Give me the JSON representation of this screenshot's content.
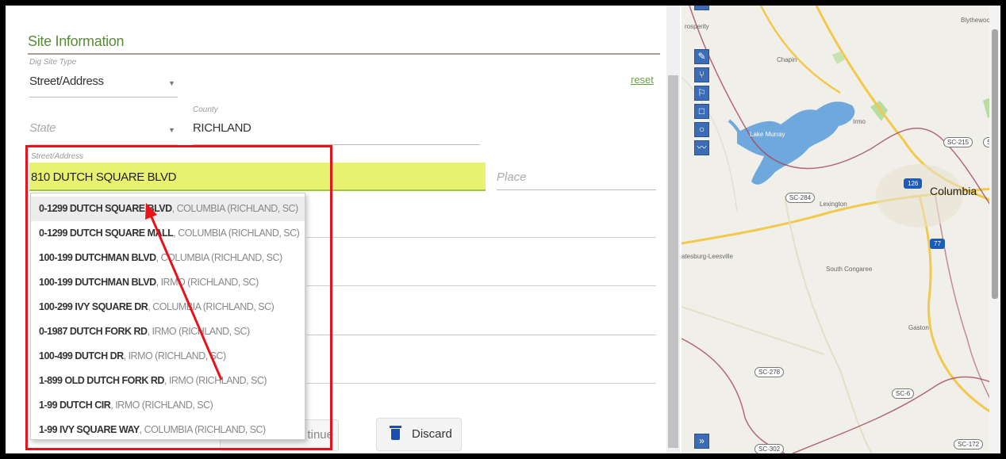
{
  "section": {
    "title": "Site Information"
  },
  "dig_site_type": {
    "label": "Dig Site Type",
    "value": "Street/Address"
  },
  "reset_label": "reset",
  "state": {
    "placeholder": "State"
  },
  "county": {
    "label": "County",
    "value": "RICHLAND"
  },
  "street": {
    "label": "Street/Address",
    "value": "810 DUTCH SQUARE BLVD"
  },
  "place": {
    "placeholder": "Place"
  },
  "suggestions": [
    {
      "main": "0-1299 DUTCH SQUARE BLVD",
      "detail": ", COLUMBIA (RICHLAND, SC)"
    },
    {
      "main": "0-1299 DUTCH SQUARE MALL",
      "detail": ", COLUMBIA (RICHLAND, SC)"
    },
    {
      "main": "100-199 DUTCHMAN BLVD",
      "detail": ", COLUMBIA (RICHLAND, SC)"
    },
    {
      "main": "100-199 DUTCHMAN BLVD",
      "detail": ", IRMO (RICHLAND, SC)"
    },
    {
      "main": "100-299 IVY SQUARE DR",
      "detail": ", COLUMBIA (RICHLAND, SC)"
    },
    {
      "main": "0-1987 DUTCH FORK RD",
      "detail": ", IRMO (RICHLAND, SC)"
    },
    {
      "main": "100-499 DUTCH DR",
      "detail": ", IRMO (RICHLAND, SC)"
    },
    {
      "main": "1-899 OLD DUTCH FORK RD",
      "detail": ", IRMO (RICHLAND, SC)"
    },
    {
      "main": "1-99 DUTCH CIR",
      "detail": ", IRMO (RICHLAND, SC)"
    },
    {
      "main": "1-99 IVY SQUARE WAY",
      "detail": ", COLUMBIA (RICHLAND, SC)"
    }
  ],
  "buttons": {
    "continue_label": "tinue",
    "discard_label": "Discard"
  },
  "map": {
    "labels": {
      "prosperity": "rosperity",
      "blythewood": "Blythewoo",
      "chapin": "Chapin",
      "lake_murray": "Lake Murray",
      "irmo": "Irmo",
      "columbia": "Columbia",
      "lexington": "Lexington",
      "batesburg": "atesburg-Leesville",
      "south_congaree": "South Congaree",
      "gaston": "Gaston"
    },
    "shields": {
      "sc215": "SC-215",
      "sc_edge": "SC-",
      "i126": "126",
      "sc284": "SC-284",
      "i77": "77",
      "sc278": "SC-278",
      "sc6": "SC-6",
      "sc172": "SC-172",
      "sc302": "SC-302"
    },
    "colors": {
      "lake": "#6fa8dc",
      "toolbar": "#3c6cb5",
      "highway": "#f2c94c",
      "border": "#a4465a"
    }
  },
  "highlight_colors": {
    "annotation": "#e8121b",
    "field_highlight": "#e9f270"
  }
}
